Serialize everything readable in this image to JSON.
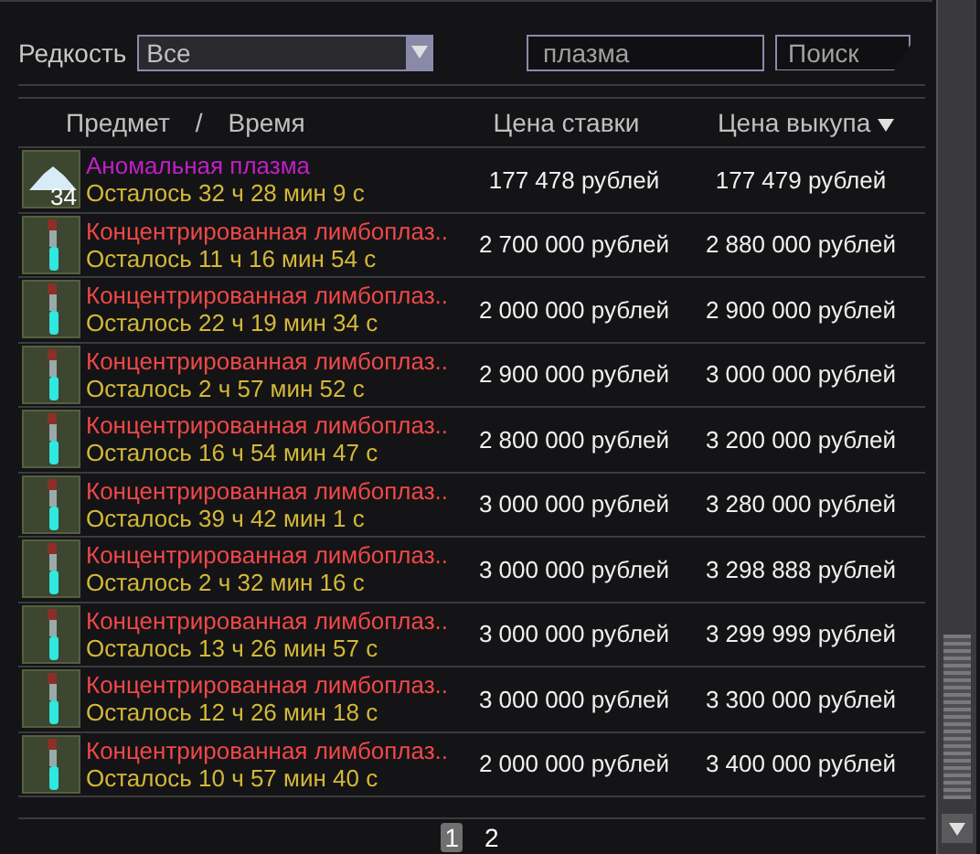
{
  "filters": {
    "rarity_label": "Редкость",
    "rarity_value": "Все",
    "search_value": "плазма",
    "search_button": "Поиск"
  },
  "table": {
    "columns": [
      {
        "label": "Предмет",
        "sorted": false
      },
      {
        "label": "/",
        "sorted": false
      },
      {
        "label": "Время",
        "sorted": false
      },
      {
        "label": "Цена ставки",
        "sorted": false
      },
      {
        "label": "Цена выкупа",
        "sorted": true
      }
    ],
    "rows": [
      {
        "kind": "plasma",
        "count": "34",
        "name": "Аномальная плазма",
        "color": "#c020c8",
        "time": "Осталось 32 ч 28 мин 9 с",
        "bid": "177 478 рублей",
        "buyout": "177 479 рублей"
      },
      {
        "kind": "vial",
        "name": "Концентрированная лимбоплаз..",
        "color": "#f04848",
        "time": "Осталось 11 ч 16 мин 54 с",
        "bid": "2 700 000 рублей",
        "buyout": "2 880 000 рублей"
      },
      {
        "kind": "vial",
        "name": "Концентрированная лимбоплаз..",
        "color": "#f04848",
        "time": "Осталось 22 ч 19 мин 34 с",
        "bid": "2 000 000 рублей",
        "buyout": "2 900 000 рублей"
      },
      {
        "kind": "vial",
        "name": "Концентрированная лимбоплаз..",
        "color": "#f04848",
        "time": "Осталось 2 ч 57 мин 52 с",
        "bid": "2 900 000 рублей",
        "buyout": "3 000 000 рублей"
      },
      {
        "kind": "vial",
        "name": "Концентрированная лимбоплаз..",
        "color": "#f04848",
        "time": "Осталось 16 ч 54 мин 47 с",
        "bid": "2 800 000 рублей",
        "buyout": "3 200 000 рублей"
      },
      {
        "kind": "vial",
        "name": "Концентрированная лимбоплаз..",
        "color": "#f04848",
        "time": "Осталось 39 ч 42 мин 1 с",
        "bid": "3 000 000 рублей",
        "buyout": "3 280 000 рублей"
      },
      {
        "kind": "vial",
        "name": "Концентрированная лимбоплаз..",
        "color": "#f04848",
        "time": "Осталось 2 ч 32 мин 16 с",
        "bid": "3 000 000 рублей",
        "buyout": "3 298 888 рублей"
      },
      {
        "kind": "vial",
        "name": "Концентрированная лимбоплаз..",
        "color": "#f04848",
        "time": "Осталось 13 ч 26 мин 57 с",
        "bid": "3 000 000 рублей",
        "buyout": "3 299 999 рублей"
      },
      {
        "kind": "vial",
        "name": "Концентрированная лимбоплаз..",
        "color": "#f04848",
        "time": "Осталось 12 ч 26 мин 18 с",
        "bid": "3 000 000 рублей",
        "buyout": "3 300 000 рублей"
      },
      {
        "kind": "vial",
        "name": "Концентрированная лимбоплаз..",
        "color": "#f04848",
        "time": "Осталось 10 ч 57 мин 40 с",
        "bid": "2 000 000 рублей",
        "buyout": "3 400 000 рублей"
      }
    ]
  },
  "pager": [
    {
      "label": "1",
      "selected": true
    },
    {
      "label": "2",
      "selected": false
    }
  ]
}
